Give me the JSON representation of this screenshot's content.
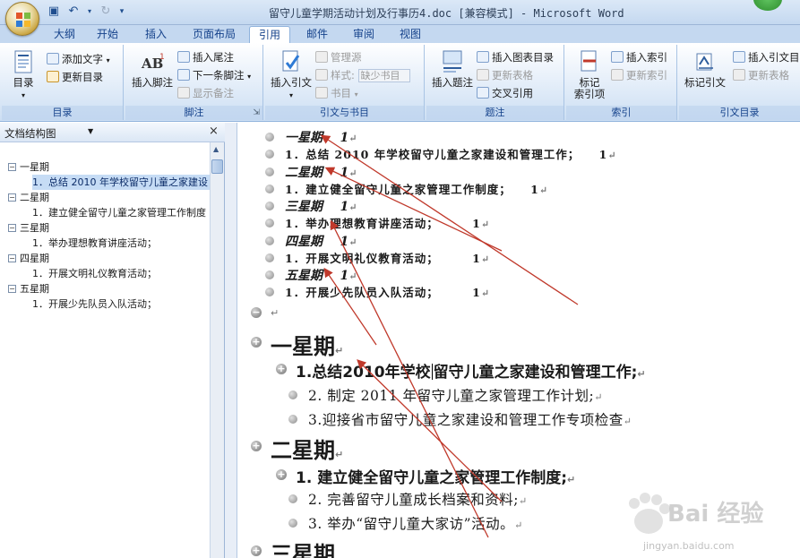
{
  "window": {
    "title": "留守儿童学期活动计划及行事历4.doc [兼容模式] - Microsoft Word"
  },
  "ribbon_tabs": [
    "大纲",
    "开始",
    "插入",
    "页面布局",
    "引用",
    "邮件",
    "审阅",
    "视图"
  ],
  "active_tab": "引用",
  "ribbon": {
    "toc": {
      "big": "目录",
      "add_text": "添加文字",
      "update_toc": "更新目录",
      "label": "目录"
    },
    "footnotes": {
      "insert_footnote": "插入脚注",
      "insert_endnote": "插入尾注",
      "next_footnote": "下一条脚注",
      "show_notes": "显示备注",
      "label": "脚注"
    },
    "citations": {
      "insert_citation": "插入引文",
      "manage_sources": "管理源",
      "style_label": "样式:",
      "style_value": "缺少书目",
      "bibliography": "书目",
      "label": "引文与书目"
    },
    "captions": {
      "insert_caption": "插入题注",
      "insert_table_of_figures": "插入图表目录",
      "update_table": "更新表格",
      "cross_reference": "交叉引用",
      "label": "题注"
    },
    "index": {
      "mark_entry": "标记\n索引项",
      "insert_index": "插入索引",
      "update_index": "更新索引",
      "label": "索引"
    },
    "authorities": {
      "mark_citation": "标记引文",
      "insert_toa": "插入引文目",
      "update_table": "更新表格",
      "label": "引文目录"
    }
  },
  "nav_pane": {
    "title": "文档结构图",
    "close": "×",
    "tree": [
      {
        "level": 1,
        "label": "一星期"
      },
      {
        "level": 2,
        "label": "1．总结 2010 年学校留守儿童之家建设",
        "selected": true
      },
      {
        "level": 1,
        "label": "二星期"
      },
      {
        "level": 2,
        "label": "1．建立健全留守儿童之家管理工作制度"
      },
      {
        "level": 1,
        "label": "三星期"
      },
      {
        "level": 2,
        "label": "1．举办理想教育讲座活动；"
      },
      {
        "level": 1,
        "label": "四星期"
      },
      {
        "level": 2,
        "label": "1．开展文明礼仪教育活动；"
      },
      {
        "level": 1,
        "label": "五星期"
      },
      {
        "level": 2,
        "label": "1．开展少先队员入队活动；"
      }
    ]
  },
  "document": {
    "toc_lines": [
      {
        "kind": "h",
        "text": "一星期",
        "page": "1"
      },
      {
        "kind": "i",
        "text": "1．总结 2010 年学校留守儿童之家建设和管理工作；",
        "page": "1"
      },
      {
        "kind": "h",
        "text": "二星期",
        "page": "1"
      },
      {
        "kind": "i",
        "text": "1．建立健全留守儿童之家管理工作制度；",
        "page": "1"
      },
      {
        "kind": "h",
        "text": "三星期",
        "page": "1"
      },
      {
        "kind": "i",
        "text": "1．举办理想教育讲座活动；",
        "page": "1"
      },
      {
        "kind": "h",
        "text": "四星期",
        "page": "1"
      },
      {
        "kind": "i",
        "text": "1．开展文明礼仪教育活动；",
        "page": "1"
      },
      {
        "kind": "h",
        "text": "五星期",
        "page": "1"
      },
      {
        "kind": "i",
        "text": "1．开展少先队员入队活动；",
        "page": "1"
      }
    ],
    "para_mark": "↵",
    "body": {
      "week1": {
        "title": "一星期",
        "item1_pre": "1.总结2010年学校",
        "item1_post": "留守儿童之家建设和管理工作;",
        "sub1": "2. 制定 2011 年留守儿童之家管理工作计划;",
        "sub2": "3.迎接省市留守儿童之家建设和管理工作专项检查"
      },
      "week2": {
        "title": "二星期",
        "item1": "1. 建立健全留守儿童之家管理工作制度;",
        "sub1": "2. 完善留守儿童成长档案和资料;",
        "sub2": "3. 举办“留守儿童大家访”活动。"
      },
      "week3": {
        "title": "三星期"
      }
    }
  },
  "watermark": {
    "brand": "Bai 经验",
    "url": "jingyan.baidu.com"
  },
  "colors": {
    "accent": "#15428b",
    "arrow": "#c0392b",
    "ribbon_bg": "#dbe8f7"
  }
}
